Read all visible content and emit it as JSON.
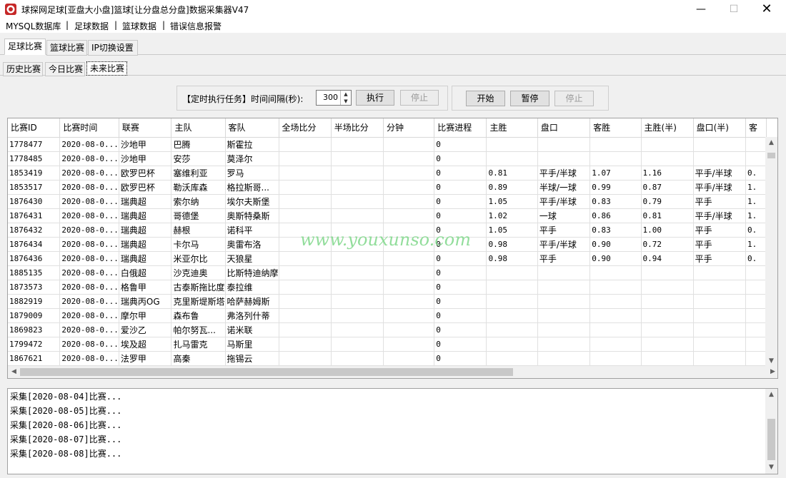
{
  "window": {
    "title": "球探网足球[亚盘大小盘]篮球[让分盘总分盘]数据采集器V47",
    "minimize": "—",
    "maximize": "☐",
    "close": "✕"
  },
  "menu": {
    "items": [
      "MYSQL数据库",
      "足球数据",
      "篮球数据",
      "错误信息报警"
    ],
    "separator": "|"
  },
  "main_tabs": [
    "足球比赛",
    "篮球比赛",
    "IP切换设置"
  ],
  "sub_tabs": [
    "历史比赛",
    "今日比赛",
    "未来比赛"
  ],
  "schedule": {
    "label": "【定时执行任务】时间间隔(秒):",
    "interval": "300",
    "execute": "执行",
    "stop": "停止"
  },
  "controls": {
    "start": "开始",
    "pause": "暂停",
    "stop": "停止"
  },
  "table": {
    "columns": [
      "比赛ID",
      "比赛时间",
      "联赛",
      "主队",
      "客队",
      "全场比分",
      "半场比分",
      "分钟",
      "比赛进程",
      "主胜",
      "盘口",
      "客胜",
      "主胜(半)",
      "盘口(半)",
      "客"
    ],
    "rows": [
      [
        "1778477",
        "2020-08-0...",
        "沙地甲",
        "巴腾",
        "斯霍拉",
        "",
        "",
        "",
        "0",
        "",
        "",
        "",
        "",
        "",
        ""
      ],
      [
        "1778485",
        "2020-08-0...",
        "沙地甲",
        "安莎",
        "莫泽尔",
        "",
        "",
        "",
        "0",
        "",
        "",
        "",
        "",
        "",
        ""
      ],
      [
        "1853419",
        "2020-08-0...",
        "欧罗巴杯",
        "塞维利亚",
        "罗马",
        "",
        "",
        "",
        "0",
        "0.81",
        "平手/半球",
        "1.07",
        "1.16",
        "平手/半球",
        "0."
      ],
      [
        "1853517",
        "2020-08-0...",
        "欧罗巴杯",
        "勒沃库森",
        "格拉斯哥...",
        "",
        "",
        "",
        "0",
        "0.89",
        "半球/一球",
        "0.99",
        "0.87",
        "平手/半球",
        "1."
      ],
      [
        "1876430",
        "2020-08-0...",
        "瑞典超",
        "索尔纳",
        "埃尔夫斯堡",
        "",
        "",
        "",
        "0",
        "1.05",
        "平手/半球",
        "0.83",
        "0.79",
        "平手",
        "1."
      ],
      [
        "1876431",
        "2020-08-0...",
        "瑞典超",
        "哥德堡",
        "奥斯特桑斯",
        "",
        "",
        "",
        "0",
        "1.02",
        "一球",
        "0.86",
        "0.81",
        "平手/半球",
        "1."
      ],
      [
        "1876432",
        "2020-08-0...",
        "瑞典超",
        "赫根",
        "诺科平",
        "",
        "",
        "",
        "0",
        "1.05",
        "平手",
        "0.83",
        "1.00",
        "平手",
        "0."
      ],
      [
        "1876434",
        "2020-08-0...",
        "瑞典超",
        "卡尔马",
        "奥雷布洛",
        "",
        "",
        "",
        "0",
        "0.98",
        "平手/半球",
        "0.90",
        "0.72",
        "平手",
        "1."
      ],
      [
        "1876436",
        "2020-08-0...",
        "瑞典超",
        "米亚尔比",
        "天狼星",
        "",
        "",
        "",
        "0",
        "0.98",
        "平手",
        "0.90",
        "0.94",
        "平手",
        "0."
      ],
      [
        "1885135",
        "2020-08-0...",
        "白俄超",
        "沙克迪奥",
        "比斯特迪纳摩",
        "",
        "",
        "",
        "0",
        "",
        "",
        "",
        "",
        "",
        ""
      ],
      [
        "1873573",
        "2020-08-0...",
        "格鲁甲",
        "古泰斯拖比度",
        "泰拉维",
        "",
        "",
        "",
        "0",
        "",
        "",
        "",
        "",
        "",
        ""
      ],
      [
        "1882919",
        "2020-08-0...",
        "瑞典丙OG",
        "克里斯堤斯塔",
        "哈萨赫姆斯",
        "",
        "",
        "",
        "0",
        "",
        "",
        "",
        "",
        "",
        ""
      ],
      [
        "1879009",
        "2020-08-0...",
        "摩尔甲",
        "森布鲁",
        "弗洛列什蒂",
        "",
        "",
        "",
        "0",
        "",
        "",
        "",
        "",
        "",
        ""
      ],
      [
        "1869823",
        "2020-08-0...",
        "爱沙乙",
        "帕尔努瓦...",
        "诺米联",
        "",
        "",
        "",
        "0",
        "",
        "",
        "",
        "",
        "",
        ""
      ],
      [
        "1799472",
        "2020-08-0...",
        "埃及超",
        "扎马雷克",
        "马斯里",
        "",
        "",
        "",
        "0",
        "",
        "",
        "",
        "",
        "",
        ""
      ],
      [
        "1867621",
        "2020-08-0...",
        "法罗甲",
        "高秦",
        "拖锡云",
        "",
        "",
        "",
        "0",
        "",
        "",
        "",
        "",
        "",
        ""
      ]
    ]
  },
  "watermark": "www.youxunso.com",
  "log": {
    "lines": [
      "采集[2020-08-04]比赛...",
      "采集[2020-08-05]比赛...",
      "采集[2020-08-06]比赛...",
      "采集[2020-08-07]比赛...",
      "采集[2020-08-08]比赛..."
    ]
  },
  "icons": {
    "app": "app-logo-icon",
    "scroll_up": "▲",
    "scroll_down": "▼",
    "scroll_left": "◀",
    "scroll_right": "▶",
    "spin_up": "▲",
    "spin_down": "▼"
  }
}
